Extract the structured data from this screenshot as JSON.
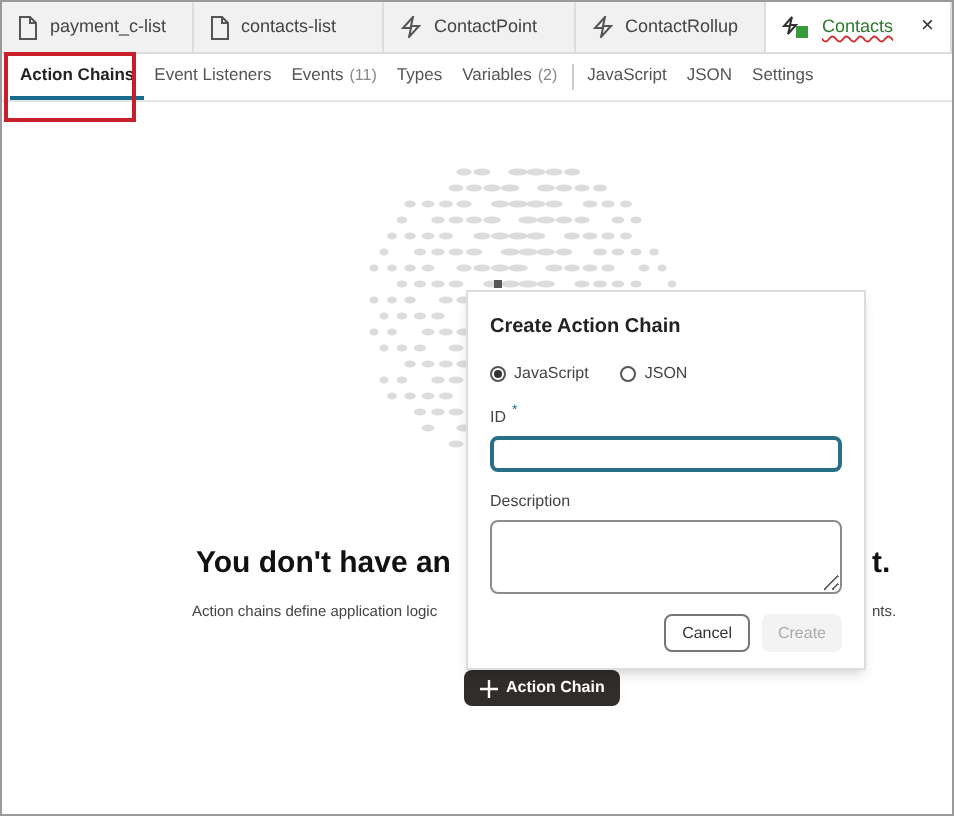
{
  "file_tabs": [
    {
      "label": "payment_c-list",
      "kind": "page",
      "selected": false
    },
    {
      "label": "contacts-list",
      "kind": "page",
      "selected": false
    },
    {
      "label": "ContactPoint",
      "kind": "flow",
      "selected": false
    },
    {
      "label": "ContactRollup",
      "kind": "flow",
      "selected": false
    },
    {
      "label": "Contacts",
      "kind": "app",
      "selected": true,
      "close": "×"
    }
  ],
  "editor_tabs": [
    {
      "label": "Action Chains",
      "selected": true
    },
    {
      "label": "Event Listeners",
      "selected": false
    },
    {
      "label": "Events",
      "count": "(11)",
      "selected": false
    },
    {
      "label": "Types",
      "selected": false
    },
    {
      "label": "Variables",
      "count": "(2)",
      "selected": false,
      "divider_after": true
    },
    {
      "label": "JavaScript",
      "selected": false
    },
    {
      "label": "JSON",
      "selected": false
    },
    {
      "label": "Settings",
      "selected": false
    }
  ],
  "empty_state": {
    "heading_parts": [
      "You don't have an",
      "t."
    ],
    "description_parts": [
      "Action chains define application logic",
      "nts."
    ],
    "button": "Action Chain"
  },
  "dialog": {
    "title": "Create Action Chain",
    "options": [
      {
        "label": "JavaScript",
        "selected": true
      },
      {
        "label": "JSON",
        "selected": false
      }
    ],
    "id_field": {
      "label": "ID",
      "required_mark": "*"
    },
    "description_field": {
      "label": "Description"
    },
    "buttons": [
      {
        "label": "Cancel",
        "disabled": false
      },
      {
        "label": "Create",
        "disabled": true
      }
    ]
  }
}
